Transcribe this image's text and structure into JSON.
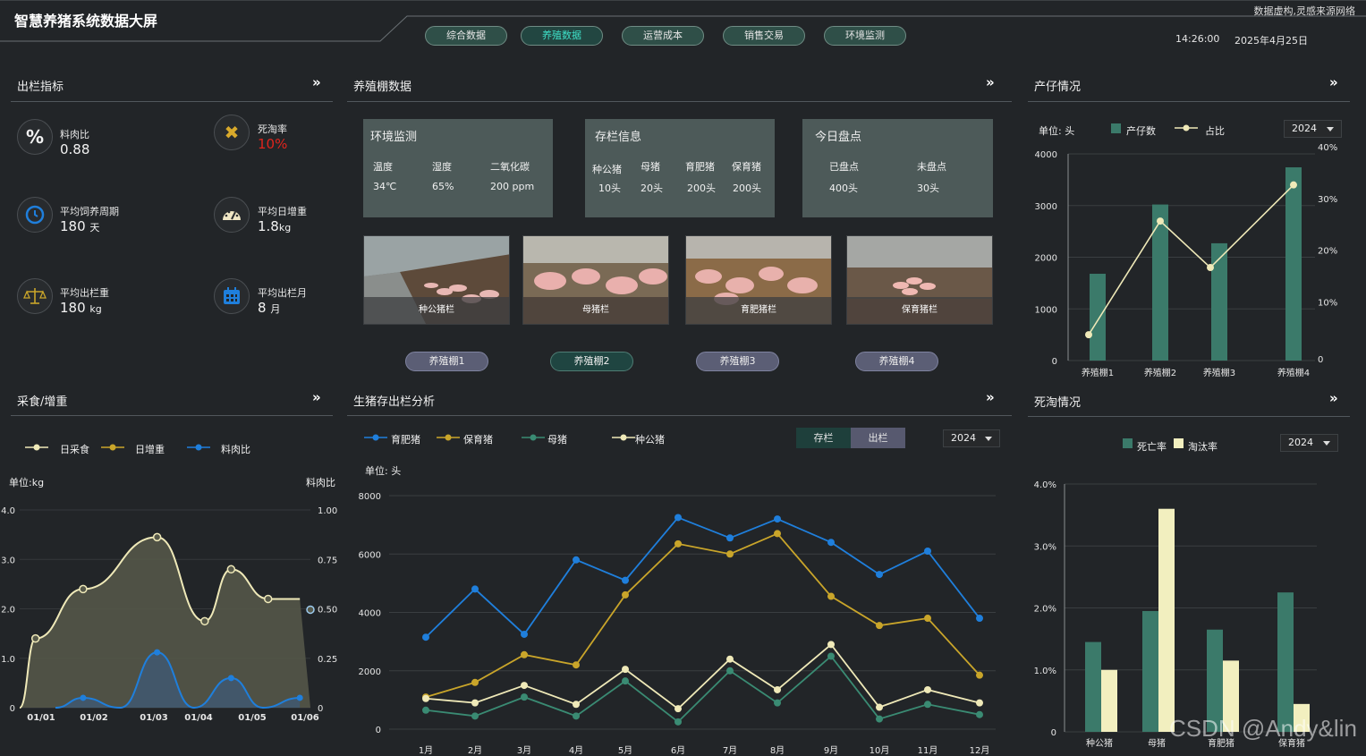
{
  "header": {
    "title": "智慧养猪系统数据大屏",
    "note": "数据虚构,灵感来源网络",
    "time": "14:26:00",
    "date": "2025年4月25日",
    "nav": [
      "综合数据",
      "养殖数据",
      "运营成本",
      "销售交易",
      "环境监测"
    ]
  },
  "colors": {
    "green": "#3b7a6a",
    "cream": "#efe9b8",
    "blue": "#1f7fdc",
    "gold": "#c9a52a",
    "teal": "#3a8b73"
  },
  "out": {
    "title": "出栏指标",
    "kpis": [
      {
        "label": "料肉比",
        "value": "0.88",
        "unit": "",
        "icon": "percent-icon"
      },
      {
        "label": "死淘率",
        "value": "10%",
        "unit": "",
        "icon": "x-icon"
      },
      {
        "label": "平均饲养周期",
        "value": "180",
        "unit": "天",
        "icon": "clock-icon"
      },
      {
        "label": "平均日增重",
        "value": "1.8",
        "unit": "kg",
        "icon": "gauge-icon"
      },
      {
        "label": "平均出栏重",
        "value": "180",
        "unit": "kg",
        "icon": "scale-icon"
      },
      {
        "label": "平均出栏月",
        "value": "8",
        "unit": "月",
        "icon": "calendar-icon"
      }
    ]
  },
  "farm": {
    "title": "养殖棚数据",
    "env": {
      "title": "环境监测",
      "headers": [
        "温度",
        "湿度",
        "二氧化碳"
      ],
      "values": [
        "34℃",
        "65%",
        "200 ppm"
      ]
    },
    "stock": {
      "title": "存栏信息",
      "headers": [
        "种公猪",
        "母猪",
        "育肥猪",
        "保育猪"
      ],
      "values": [
        "10头",
        "20头",
        "200头",
        "200头"
      ]
    },
    "today": {
      "title": "今日盘点",
      "headers": [
        "已盘点",
        "未盘点"
      ],
      "values": [
        "400头",
        "30头"
      ]
    },
    "photos": [
      "种公猪栏",
      "母猪栏",
      "育肥猪栏",
      "保育猪栏"
    ],
    "pens": [
      "养殖棚1",
      "养殖棚2",
      "养殖棚3",
      "养殖棚4"
    ]
  },
  "birth": {
    "title": "产仔情况",
    "unit": "单位: 头",
    "year": "2024",
    "legend": [
      "产仔数",
      "占比"
    ]
  },
  "feed": {
    "title": "采食/增重",
    "legend": [
      "日采食",
      "日增重",
      "料肉比"
    ],
    "unit_l": "单位:kg",
    "unit_r": "料肉比"
  },
  "stockAna": {
    "title": "生猪存出栏分析",
    "unit": "单位: 头",
    "year": "2024",
    "toggle": [
      "存栏",
      "出栏"
    ],
    "legend": [
      "育肥猪",
      "保育猪",
      "母猪",
      "种公猪"
    ]
  },
  "death": {
    "title": "死淘情况",
    "year": "2024",
    "legend": [
      "死亡率",
      "淘汰率"
    ]
  },
  "watermark": "CSDN @Andy&lin",
  "chart_data": [
    {
      "type": "bar",
      "title": "产仔情况",
      "categories": [
        "养殖棚1",
        "养殖棚2",
        "养殖棚3",
        "养殖棚4"
      ],
      "series": [
        {
          "name": "产仔数",
          "values": [
            1680,
            3020,
            2270,
            3740
          ]
        },
        {
          "name": "占比",
          "values": [
            5,
            27,
            18,
            34
          ]
        }
      ],
      "ylim": [
        0,
        4000
      ],
      "y2lim": [
        0,
        40
      ],
      "yticks": [
        "0",
        "1000",
        "2000",
        "3000",
        "4000"
      ],
      "y2ticks": [
        "0",
        "10%",
        "20%",
        "30%",
        "40%"
      ]
    },
    {
      "type": "area",
      "title": "采食/增重",
      "categories": [
        "01/01",
        "01/02",
        "01/03",
        "01/04",
        "01/05",
        "01/06"
      ],
      "x": [
        0.3,
        1.2,
        2.6,
        3.5,
        4.0,
        4.7,
        5.3
      ],
      "series": [
        {
          "name": "日采食",
          "x": [
            0.3,
            1.2,
            2.6,
            3.5,
            4.0,
            4.7,
            5.3
          ],
          "values": [
            1.4,
            2.4,
            3.45,
            1.75,
            2.8,
            2.2,
            2.2
          ]
        },
        {
          "name": "日增重",
          "values": [
            0.1,
            0.7,
            0.35
          ]
        },
        {
          "name": "料肉比",
          "x": [
            1.2,
            2.6,
            4.0,
            5.3
          ],
          "values": [
            0.05,
            0.28,
            0.15,
            0.05
          ]
        }
      ],
      "ylim": [
        0,
        4.0
      ],
      "y2lim": [
        0,
        1.0
      ],
      "yticks": [
        "0",
        "1.0",
        "2.0",
        "3.0",
        "4.0"
      ],
      "y2ticks": [
        "0",
        "0.25",
        "0.50",
        "0.75",
        "1.00"
      ]
    },
    {
      "type": "line",
      "title": "生猪存出栏分析",
      "categories": [
        "1月",
        "2月",
        "3月",
        "4月",
        "5月",
        "6月",
        "7月",
        "8月",
        "9月",
        "10月",
        "11月",
        "12月"
      ],
      "series": [
        {
          "name": "育肥猪",
          "values": [
            3150,
            4800,
            3250,
            5800,
            5100,
            7250,
            6550,
            7200,
            6400,
            5300,
            6100,
            3800
          ]
        },
        {
          "name": "保育猪",
          "values": [
            1100,
            1600,
            2550,
            2200,
            4600,
            6350,
            6000,
            6700,
            4550,
            3550,
            3800,
            1850
          ]
        },
        {
          "name": "母猪",
          "values": [
            650,
            450,
            1100,
            450,
            1650,
            250,
            2000,
            900,
            2500,
            350,
            850,
            500
          ]
        },
        {
          "name": "种公猪",
          "values": [
            1050,
            900,
            1500,
            850,
            2050,
            700,
            2400,
            1350,
            2900,
            750,
            1350,
            900
          ]
        }
      ],
      "ylim": [
        0,
        8000
      ],
      "yticks": [
        "0",
        "2000",
        "4000",
        "6000",
        "8000"
      ]
    },
    {
      "type": "bar",
      "title": "死淘情况",
      "categories": [
        "种公猪",
        "母猪",
        "育肥猪",
        "保育猪"
      ],
      "series": [
        {
          "name": "死亡率",
          "values": [
            1.45,
            1.95,
            1.65,
            2.25
          ]
        },
        {
          "name": "淘汰率",
          "values": [
            1.0,
            3.6,
            1.15,
            0.45
          ]
        }
      ],
      "ylim": [
        0,
        4.0
      ],
      "yticks": [
        "0",
        "1.0%",
        "2.0%",
        "3.0%",
        "4.0%"
      ]
    }
  ]
}
